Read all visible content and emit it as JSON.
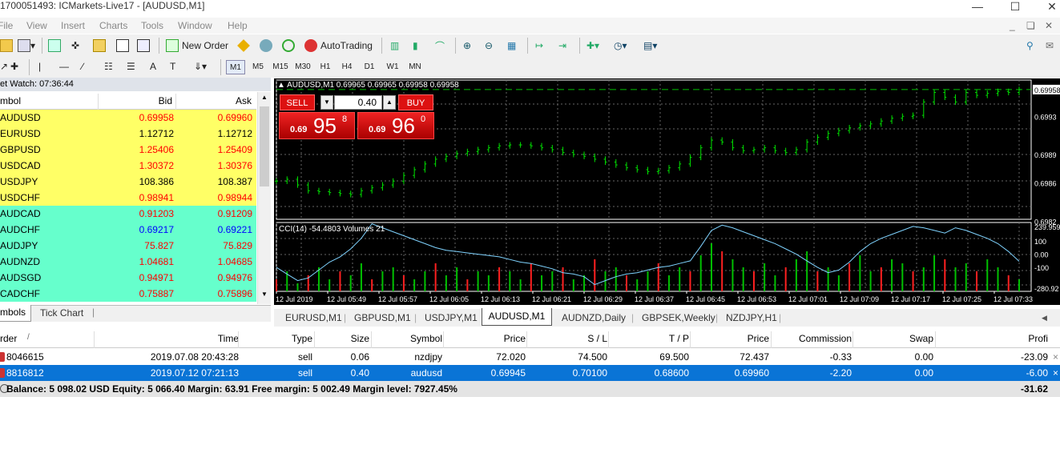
{
  "window": {
    "title": "1700051493: ICMarkets-Live17 - [AUDUSD,M1]"
  },
  "menu": [
    "File",
    "View",
    "Insert",
    "Charts",
    "Tools",
    "Window",
    "Help"
  ],
  "toolbar": {
    "new_order": "New Order",
    "autotrading": "AutoTrading"
  },
  "timeframes": [
    "M1",
    "M5",
    "M15",
    "M30",
    "H1",
    "H4",
    "D1",
    "W1",
    "MN"
  ],
  "market_watch": {
    "title": "et Watch: 07:36:44",
    "col_symbol": "mbol",
    "col_bid": "Bid",
    "col_ask": "Ask",
    "rows": [
      {
        "symbol": "AUDUSD",
        "bid": "0.69958",
        "ask": "0.69960",
        "bg": "#ffff66",
        "color": "#ff0000"
      },
      {
        "symbol": "EURUSD",
        "bid": "1.12712",
        "ask": "1.12712",
        "bg": "#ffff66",
        "color": "#000000"
      },
      {
        "symbol": "GBPUSD",
        "bid": "1.25406",
        "ask": "1.25409",
        "bg": "#ffff66",
        "color": "#ff0000"
      },
      {
        "symbol": "USDCAD",
        "bid": "1.30372",
        "ask": "1.30376",
        "bg": "#ffff66",
        "color": "#ff0000"
      },
      {
        "symbol": "USDJPY",
        "bid": "108.386",
        "ask": "108.387",
        "bg": "#ffff66",
        "color": "#000000"
      },
      {
        "symbol": "USDCHF",
        "bid": "0.98941",
        "ask": "0.98944",
        "bg": "#ffff66",
        "color": "#ff0000"
      },
      {
        "symbol": "AUDCAD",
        "bid": "0.91203",
        "ask": "0.91209",
        "bg": "#66ffcc",
        "color": "#ff0000"
      },
      {
        "symbol": "AUDCHF",
        "bid": "0.69217",
        "ask": "0.69221",
        "bg": "#66ffcc",
        "color": "#0000ff"
      },
      {
        "symbol": "AUDJPY",
        "bid": "75.827",
        "ask": "75.829",
        "bg": "#66ffcc",
        "color": "#ff0000"
      },
      {
        "symbol": "AUDNZD",
        "bid": "1.04681",
        "ask": "1.04685",
        "bg": "#66ffcc",
        "color": "#ff0000"
      },
      {
        "symbol": "AUDSGD",
        "bid": "0.94971",
        "ask": "0.94976",
        "bg": "#66ffcc",
        "color": "#ff0000"
      },
      {
        "symbol": "CADCHF",
        "bid": "0.75887",
        "ask": "0.75896",
        "bg": "#66ffcc",
        "color": "#ff0000"
      }
    ],
    "tabs": [
      "mbols",
      "Tick Chart"
    ]
  },
  "chart": {
    "header": "AUDUSD,M1  0.69965 0.69965 0.69958 0.69958",
    "one_click": {
      "sell": "SELL",
      "buy": "BUY",
      "lot": "0.40",
      "sell_prefix": "0.69",
      "sell_big": "95",
      "sell_sup": "8",
      "buy_prefix": "0.69",
      "buy_big": "96",
      "buy_sup": "0"
    },
    "price_labels": [
      "0.6996",
      "0.69958",
      "0.6993",
      "0.6989",
      "0.6986",
      "0.6982"
    ],
    "indicator_header": "CCI(14) -54.4803   Volumes 21",
    "indicator_labels": [
      "239.959",
      "100",
      "0.00",
      "-100",
      "-280.92"
    ],
    "time_labels": [
      "12 Jul 2019",
      "12 Jul 05:49",
      "12 Jul 05:57",
      "12 Jul 06:05",
      "12 Jul 06:13",
      "12 Jul 06:21",
      "12 Jul 06:29",
      "12 Jul 06:37",
      "12 Jul 06:45",
      "12 Jul 06:53",
      "12 Jul 07:01",
      "12 Jul 07:09",
      "12 Jul 07:17",
      "12 Jul 07:25",
      "12 Jul 07:33"
    ],
    "price_series": [
      0.69862,
      0.69864,
      0.69858,
      0.69852,
      0.69851,
      0.6985,
      0.69849,
      0.69848,
      0.69852,
      0.69855,
      0.69858,
      0.69862,
      0.69868,
      0.69874,
      0.6988,
      0.69885,
      0.69888,
      0.69891,
      0.69893,
      0.69895,
      0.69897,
      0.69899,
      0.699,
      0.699,
      0.69899,
      0.69897,
      0.69895,
      0.69892,
      0.6989,
      0.69888,
      0.69885,
      0.69882,
      0.69879,
      0.69876,
      0.69874,
      0.69872,
      0.69873,
      0.69876,
      0.6988,
      0.69887,
      0.69897,
      0.69905,
      0.69903,
      0.69897,
      0.69894,
      0.69895,
      0.69897,
      0.69894,
      0.69892,
      0.69895,
      0.69903,
      0.69908,
      0.69912,
      0.69915,
      0.69918,
      0.6992,
      0.69922,
      0.69925,
      0.69928,
      0.6993,
      0.69931,
      0.69945,
      0.69955,
      0.6995,
      0.69945,
      0.69955,
      0.69952,
      0.69954,
      0.69956,
      0.69955,
      0.69958
    ],
    "cci_series": [
      -100,
      -150,
      -200,
      -180,
      -120,
      -60,
      -20,
      40,
      120,
      230,
      200,
      170,
      140,
      110,
      80,
      50,
      30,
      20,
      10,
      0,
      -10,
      -20,
      -40,
      -60,
      -70,
      -90,
      -110,
      -140,
      -150,
      -170,
      -230,
      -200,
      -170,
      -150,
      -140,
      -120,
      -100,
      -90,
      -70,
      -50,
      60,
      180,
      220,
      200,
      170,
      140,
      110,
      80,
      40,
      0,
      -50,
      -100,
      -140,
      -120,
      -60,
      20,
      80,
      120,
      150,
      180,
      210,
      200,
      180,
      160,
      200,
      180,
      150,
      120,
      80,
      20,
      -54
    ],
    "volume_series": [
      3,
      5,
      2,
      4,
      6,
      3,
      5,
      4,
      7,
      3,
      5,
      6,
      4,
      3,
      5,
      7,
      4,
      6,
      3,
      5,
      4,
      6,
      5,
      3,
      7,
      4,
      5,
      6,
      3,
      4,
      8,
      5,
      6,
      4,
      3,
      5,
      7,
      4,
      6,
      5,
      9,
      12,
      10,
      8,
      6,
      5,
      7,
      4,
      6,
      8,
      10,
      5,
      6,
      4,
      7,
      9,
      5,
      6,
      8,
      7,
      5,
      6,
      9,
      8,
      6,
      7,
      5,
      8,
      6,
      4,
      3
    ]
  },
  "chart_tabs": [
    "EURUSD,M1",
    "GBPUSD,M1",
    "USDJPY,M1",
    "AUDUSD,M1",
    "AUDNZD,Daily",
    "GBPSEK,Weekly",
    "NZDJPY,H1"
  ],
  "terminal": {
    "headers": {
      "order": "rder",
      "time": "Time",
      "type": "Type",
      "size": "Size",
      "symbol": "Symbol",
      "price": "Price",
      "sl": "S / L",
      "tp": "T / P",
      "price2": "Price",
      "commission": "Commission",
      "swap": "Swap",
      "profit": "Profi"
    },
    "rows": [
      {
        "order": "8046615",
        "time": "2019.07.08 20:43:28",
        "type": "sell",
        "size": "0.06",
        "symbol": "nzdjpy",
        "price": "72.020",
        "sl": "74.500",
        "tp": "69.500",
        "price2": "72.437",
        "commission": "-0.33",
        "swap": "0.00",
        "profit": "-23.09"
      },
      {
        "order": "8816812",
        "time": "2019.07.12 07:21:13",
        "type": "sell",
        "size": "0.40",
        "symbol": "audusd",
        "price": "0.69945",
        "sl": "0.70100",
        "tp": "0.68600",
        "price2": "0.69960",
        "commission": "-2.20",
        "swap": "0.00",
        "profit": "-6.00"
      }
    ],
    "balance_line": "Balance: 5 098.02 USD  Equity: 5 066.40  Margin: 63.91  Free margin: 5 002.49  Margin level: 7927.45%",
    "total_profit": "-31.62"
  }
}
